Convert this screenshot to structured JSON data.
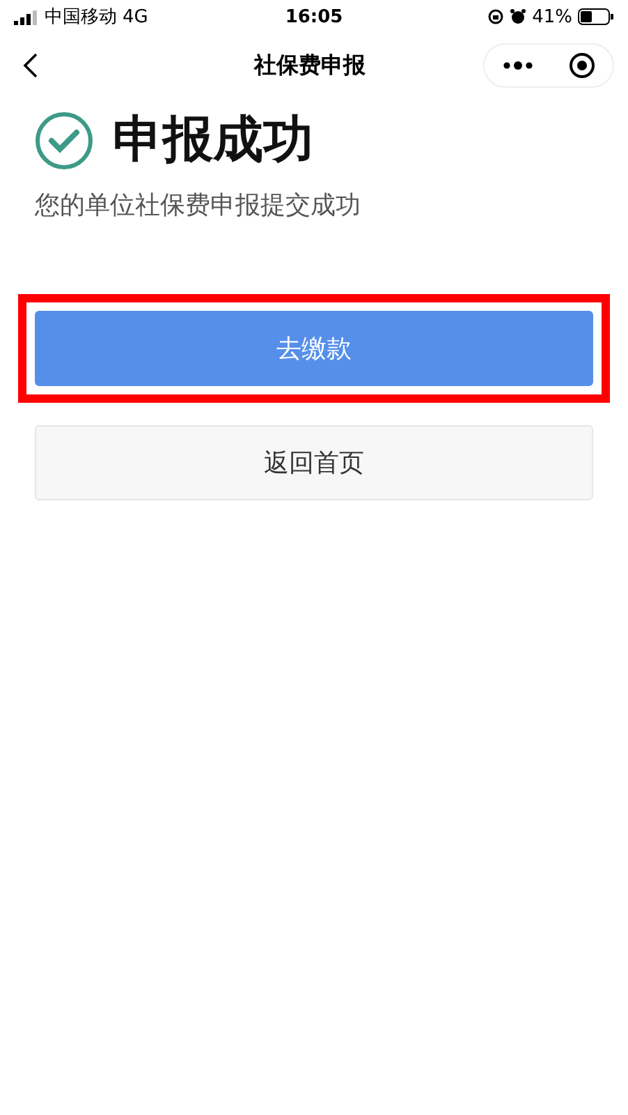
{
  "status_bar": {
    "carrier": "中国移动",
    "network": "4G",
    "time": "16:05",
    "battery": "41%"
  },
  "nav": {
    "title": "社保费申报"
  },
  "result": {
    "title": "申报成功",
    "message": "您的单位社保费申报提交成功"
  },
  "buttons": [
    {
      "label": "去缴款",
      "kind": "primary",
      "highlighted": true
    },
    {
      "label": "返回首页",
      "kind": "secondary",
      "highlighted": false
    }
  ]
}
